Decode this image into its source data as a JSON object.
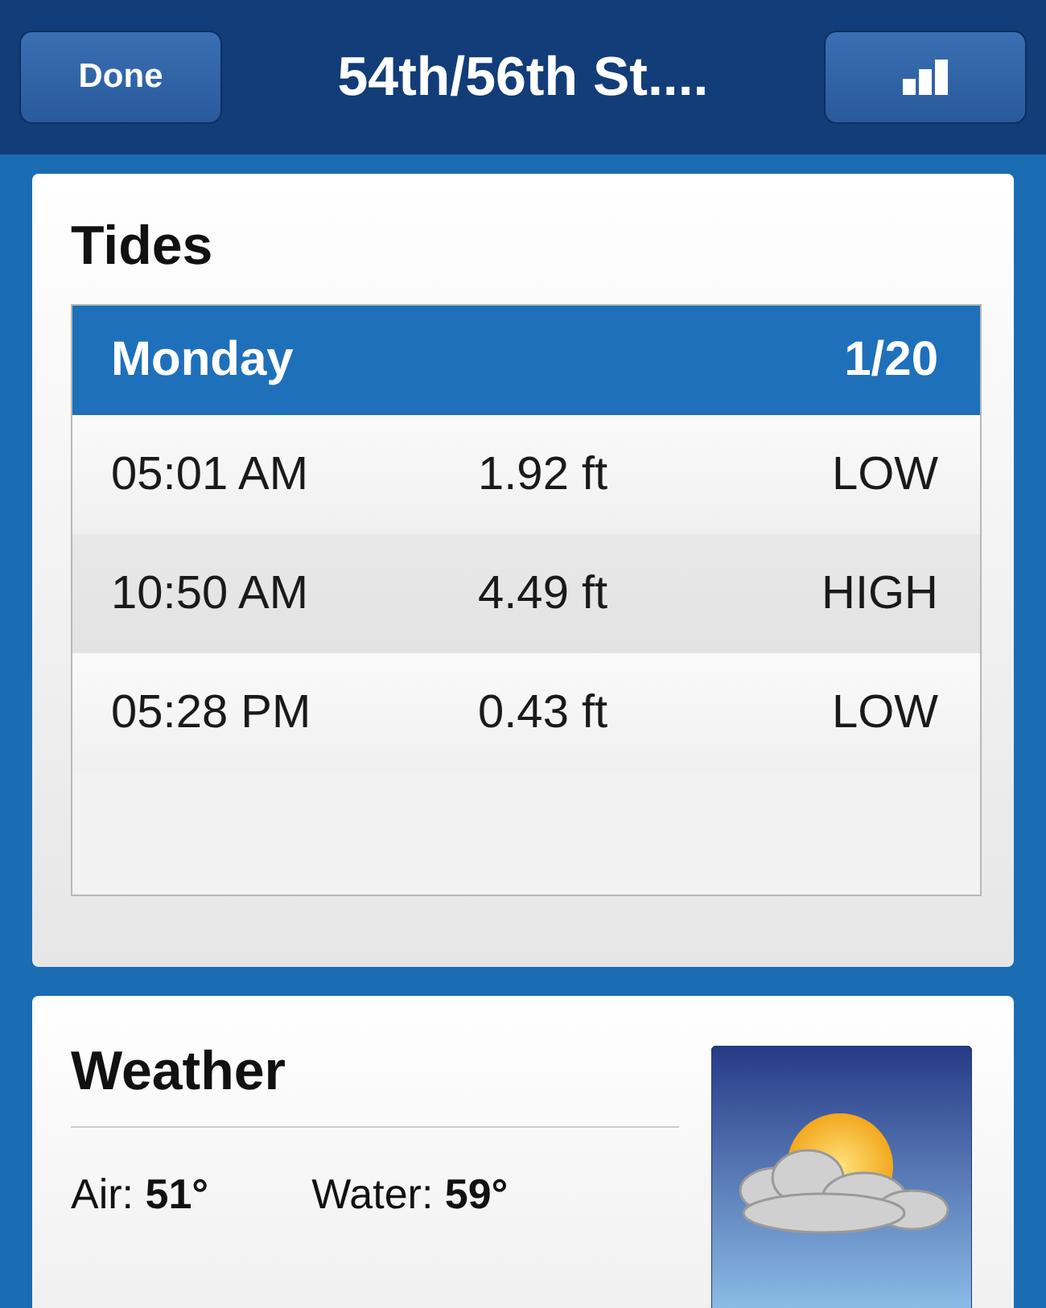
{
  "nav_bar": {
    "left_button": "Done",
    "title": "54th/56th St...."
  },
  "tides": {
    "title": "Tides",
    "day": "Monday",
    "date": "1/20",
    "rows": [
      {
        "time": "05:01 AM",
        "height": "1.92 ft",
        "type": "LOW"
      },
      {
        "time": "10:50 AM",
        "height": "4.49 ft",
        "type": "HIGH"
      },
      {
        "time": "05:28 PM",
        "height": "0.43 ft",
        "type": "LOW"
      }
    ]
  },
  "weather": {
    "title": "Weather",
    "readings": [
      "Air: **51°**",
      "Water: **59°**"
    ]
  }
}
